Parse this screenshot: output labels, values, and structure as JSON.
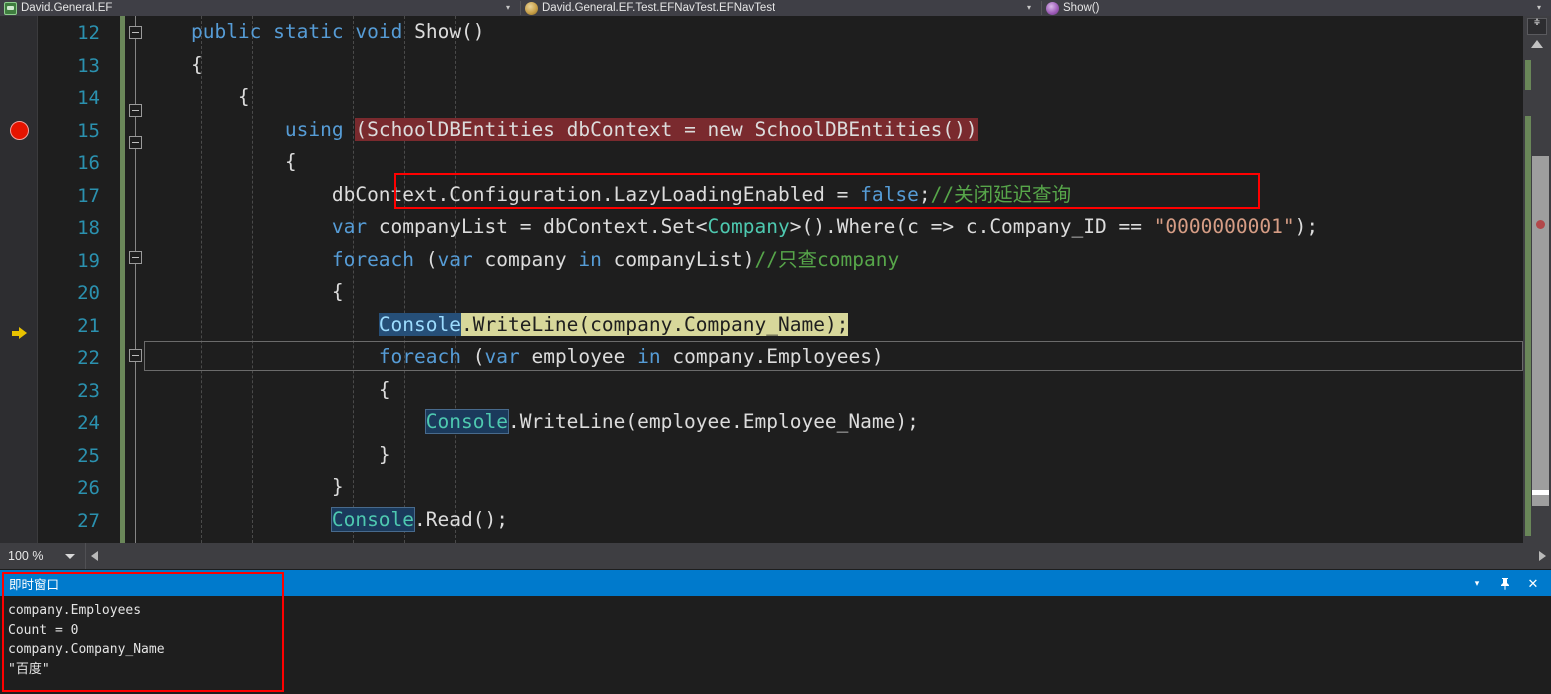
{
  "navbar": {
    "left": {
      "icon": "csharp-project-icon",
      "label": "David.General.EF",
      "chevron": "▾"
    },
    "middle": {
      "icon": "class-icon",
      "label": "David.General.EF.Test.EFNavTest.EFNavTest",
      "chevron": "▾"
    },
    "right": {
      "icon": "method-icon",
      "label": "Show()",
      "chevron": "▾"
    }
  },
  "editor": {
    "zoom_level": "100 %",
    "breakpoint_line": 15,
    "execution_line": 21,
    "lines": [
      {
        "num": "12",
        "text": "public static void Show()"
      },
      {
        "num": "13",
        "text": "{"
      },
      {
        "num": "14",
        "text": "{"
      },
      {
        "num": "15",
        "text": "using (SchoolDBEntities dbContext = new SchoolDBEntities())"
      },
      {
        "num": "16",
        "text": "{"
      },
      {
        "num": "17",
        "text": "dbContext.Configuration.LazyLoadingEnabled = false;//关闭延迟查询"
      },
      {
        "num": "18",
        "text": "var companyList = dbContext.Set<Company>().Where(c => c.Company_ID == \"0000000001\");"
      },
      {
        "num": "19",
        "text": "foreach (var company in companyList)//只查company"
      },
      {
        "num": "20",
        "text": "{"
      },
      {
        "num": "21",
        "text": "Console.WriteLine(company.Company_Name);"
      },
      {
        "num": "22",
        "text": "foreach (var employee in company.Employees)"
      },
      {
        "num": "23",
        "text": "{"
      },
      {
        "num": "24",
        "text": "Console.WriteLine(employee.Employee_Name);"
      },
      {
        "num": "25",
        "text": "}"
      },
      {
        "num": "26",
        "text": "}"
      },
      {
        "num": "27",
        "text": "Console.Read();"
      }
    ],
    "tokens": {
      "kw_public": "public",
      "kw_static": "static",
      "kw_void": "void",
      "name_show": "Show()",
      "brace_open": "{",
      "brace_close": "}",
      "kw_using": "using",
      "using_expr": "(SchoolDBEntities dbContext = new SchoolDBEntities())",
      "l17_a": "dbContext.Configuration.LazyLoadingEnabled = ",
      "l17_false": "false",
      "l17_semi": ";",
      "l17_comment": "//关闭延迟查询",
      "l18_var": "var",
      "l18_a": " companyList = dbContext.Set<",
      "l18_type": "Company",
      "l18_b": ">().Where(c => c.Company_ID == ",
      "l18_str": "\"0000000001\"",
      "l18_c": ");",
      "l19_foreach": "foreach",
      "l19_a": " (",
      "l19_var": "var",
      "l19_b": " company ",
      "l19_in": "in",
      "l19_c": " companyList)",
      "l19_comment": "//只查company",
      "l21_console": "Console",
      "l21_rest": ".WriteLine(company.Company_Name);",
      "l22_foreach": "foreach",
      "l22_a": " (",
      "l22_var": "var",
      "l22_b": " employee ",
      "l22_in": "in",
      "l22_c": " company.Employees)",
      "l24_console": "Console",
      "l24_rest": ".WriteLine(employee.Employee_Name);",
      "l27_console": "Console",
      "l27_rest": ".Read();"
    },
    "colors": {
      "background": "#1e1e1e",
      "keyword": "#569cd6",
      "type": "#4ec9b0",
      "string": "#d69d85",
      "comment": "#57a64a",
      "plain": "#dcdcdc",
      "line_number": "#2b91af",
      "breakpoint_line_bg": "#7a2a2e",
      "execution_line_bg": "#d7d79a",
      "selection_bg": "#264f78",
      "annotation_border": "#ff0000",
      "change_bar": "#6a8759"
    }
  },
  "immediate_window": {
    "title": "即时窗口",
    "actions": {
      "dropdown": "▾",
      "pin": "pin-icon",
      "close": "✕"
    },
    "output": [
      "company.Employees",
      "Count = 0",
      "company.Company_Name",
      "\"百度\""
    ]
  }
}
